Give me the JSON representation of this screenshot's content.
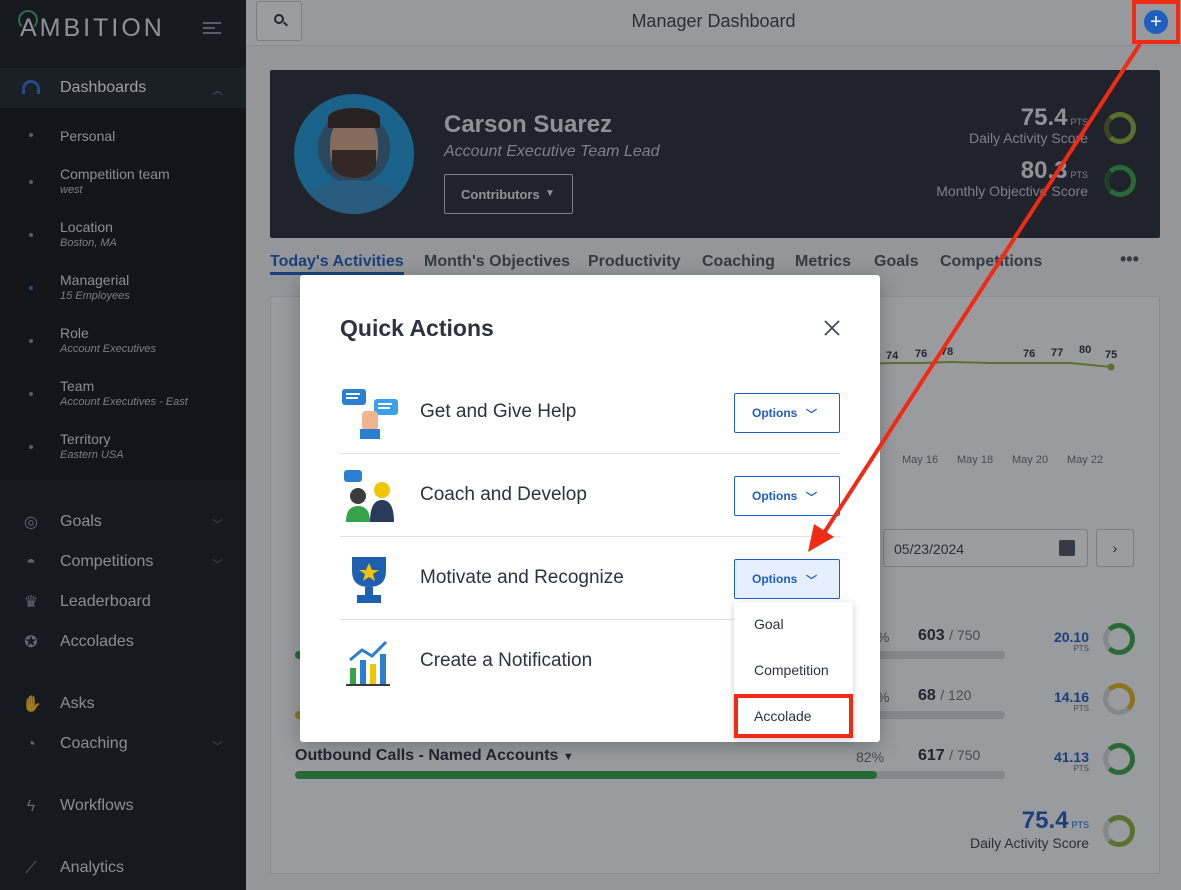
{
  "app": {
    "logo": "AMBITION",
    "page_title": "Manager Dashboard"
  },
  "sidebar": {
    "dashboards_label": "Dashboards",
    "dashboard_items": [
      {
        "label": "Personal",
        "sub": ""
      },
      {
        "label": "Competition team",
        "sub": "west"
      },
      {
        "label": "Location",
        "sub": "Boston, MA"
      },
      {
        "label": "Managerial",
        "sub": "15 Employees"
      },
      {
        "label": "Role",
        "sub": "Account Executives"
      },
      {
        "label": "Team",
        "sub": "Account Executives - East"
      },
      {
        "label": "Territory",
        "sub": "Eastern USA"
      }
    ],
    "nav": [
      {
        "label": "Goals",
        "icon": "target-icon"
      },
      {
        "label": "Competitions",
        "icon": "helmet-icon"
      },
      {
        "label": "Leaderboard",
        "icon": "trophy-icon"
      },
      {
        "label": "Accolades",
        "icon": "medal-icon"
      },
      {
        "label": "Asks",
        "icon": "hand-icon"
      },
      {
        "label": "Coaching",
        "icon": "whistle-icon"
      },
      {
        "label": "Workflows",
        "icon": "lightning-icon"
      },
      {
        "label": "Analytics",
        "icon": "chart-icon"
      }
    ]
  },
  "profile": {
    "name": "Carson Suarez",
    "role": "Account Executive Team Lead",
    "contributors_label": "Contributors",
    "daily_score": "75.4",
    "daily_label": "Daily Activity Score",
    "monthly_score": "80.3",
    "monthly_label": "Monthly Objective Score",
    "pts_label": "PTS"
  },
  "tabs": [
    "Today's Activities",
    "Month's Objectives",
    "Productivity",
    "Coaching",
    "Metrics",
    "Goals",
    "Competitions"
  ],
  "tabs_more": "•••",
  "chart": {
    "point_labels": [
      "74",
      "76",
      "78",
      "76",
      "77",
      "80",
      "75"
    ],
    "x_labels": [
      "May 16",
      "May 18",
      "May 20",
      "May 22"
    ]
  },
  "date_value": "05/23/2024",
  "metrics": [
    {
      "title": "",
      "pct": "%",
      "value": "603",
      "target": "/ 750",
      "pts": "20.10",
      "fill": 0.8
    },
    {
      "title": "",
      "pct": "%",
      "value": "68",
      "target": "/ 120",
      "pts": "14.16",
      "fill": 0.57
    },
    {
      "title": "Outbound Calls - Named Accounts",
      "pct": "82%",
      "value": "617",
      "target": "/ 750",
      "pts": "41.13",
      "fill": 0.82
    }
  ],
  "footer": {
    "score": "75.4",
    "pts": "PTS",
    "label": "Daily Activity Score"
  },
  "modal": {
    "title": "Quick Actions",
    "options_label": "Options",
    "actions": [
      {
        "label": "Get and Give Help"
      },
      {
        "label": "Coach and Develop"
      },
      {
        "label": "Motivate and Recognize"
      },
      {
        "label": "Create a Notification"
      }
    ],
    "dropdown": [
      "Goal",
      "Competition",
      "Accolade"
    ]
  },
  "colors": {
    "accent": "#1e5fbf",
    "highlight": "#ef2b15",
    "sidebar": "#1a1d24",
    "success": "#3aa64a"
  }
}
